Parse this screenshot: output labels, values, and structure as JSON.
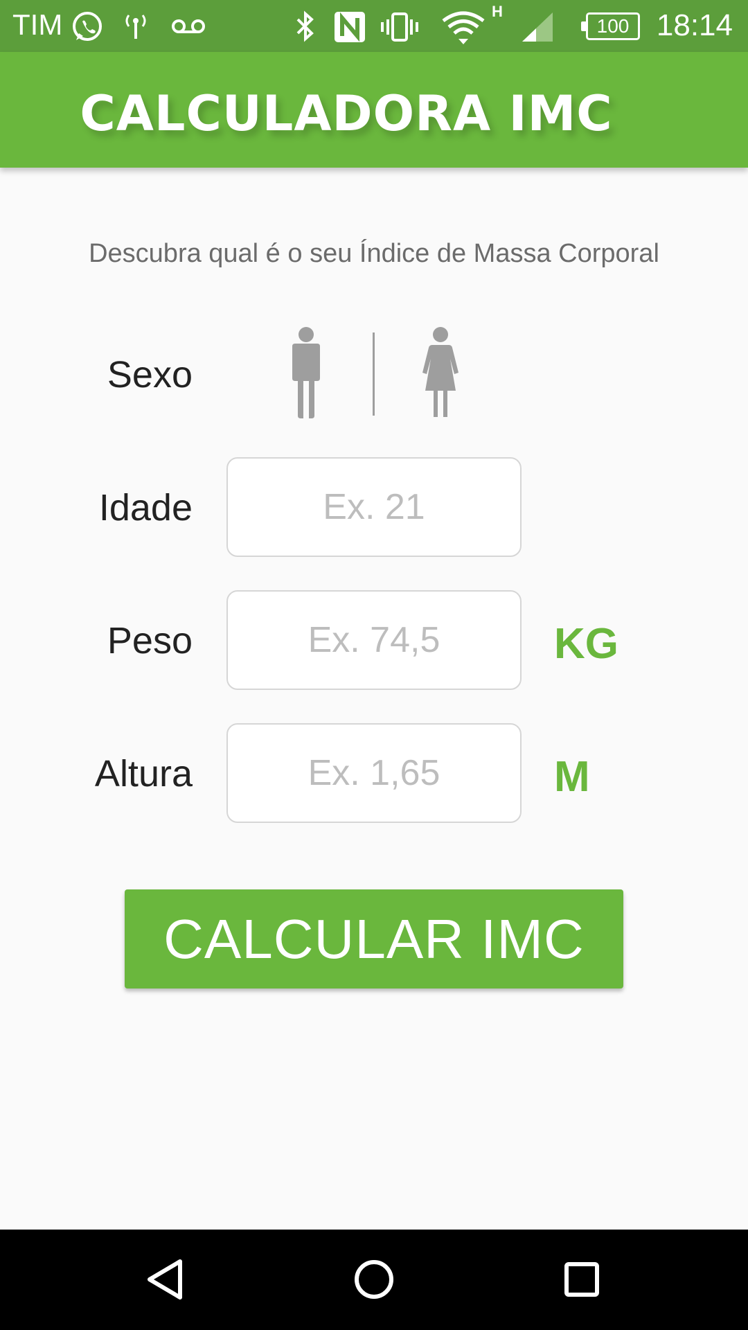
{
  "status_bar": {
    "carrier": "TIM",
    "battery": "100",
    "network_type": "H",
    "time": "18:14",
    "icons": [
      "whatsapp-icon",
      "hotspot-icon",
      "voicemail-icon",
      "bluetooth-icon",
      "nfc-icon",
      "vibrate-icon",
      "wifi-icon",
      "cell-signal-icon",
      "battery-icon"
    ]
  },
  "app_bar": {
    "title": "CALCULADORA IMC"
  },
  "main": {
    "subtitle": "Descubra qual é o seu Índice de Massa Corporal",
    "sex_label": "Sexo",
    "sex_options": [
      "male-icon",
      "female-icon"
    ],
    "age_label": "Idade",
    "age_placeholder": "Ex. 21",
    "weight_label": "Peso",
    "weight_placeholder": "Ex. 74,5",
    "weight_unit": "KG",
    "height_label": "Altura",
    "height_placeholder": "Ex. 1,65",
    "height_unit": "M",
    "calculate_label": "CALCULAR IMC"
  },
  "nav_bar": {
    "buttons": [
      "back-icon",
      "home-icon",
      "recents-icon"
    ]
  },
  "colors": {
    "accent": "#6ab73d",
    "status_bar": "#5c9e3b",
    "icon_gray": "#9e9e9e"
  }
}
